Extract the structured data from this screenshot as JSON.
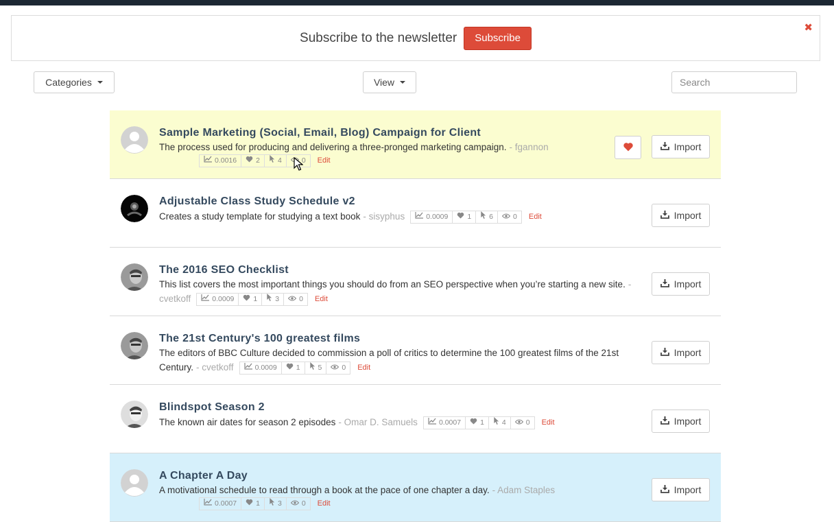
{
  "newsletter": {
    "text": "Subscribe to the newsletter",
    "button_label": "Subscribe",
    "close": "✖"
  },
  "toolbar": {
    "categories_label": "Categories",
    "view_label": "View",
    "search_placeholder": "Search"
  },
  "actions": {
    "import_label": "Import",
    "edit_label": "Edit"
  },
  "colors": {
    "accent": "#dd4b39",
    "highlight_yellow": "#fbfdd0",
    "highlight_blue": "#d6f0fb",
    "title": "#34495e"
  },
  "items": [
    {
      "title": "Sample Marketing (Social, Email, Blog) Campaign for Client",
      "description": "The process used for producing and delivering a three-pronged marketing campaign.",
      "author": "- fgannon",
      "score": "0.0016",
      "likes": "2",
      "clicks": "4",
      "views": "0",
      "highlight": "yellow",
      "liked": true,
      "avatar": "placeholder"
    },
    {
      "title": "Adjustable Class Study Schedule v2",
      "description": "Creates a study template for studying a text book",
      "author": "- sisyphus",
      "score": "0.0009",
      "likes": "1",
      "clicks": "6",
      "views": "0",
      "highlight": "none",
      "avatar": "dark"
    },
    {
      "title": "The 2016 SEO Checklist",
      "description": "This list covers the most important things you should do from an SEO perspective when you’re starting a new site.",
      "author": "- cvetkoff",
      "score": "0.0009",
      "likes": "1",
      "clicks": "3",
      "views": "0",
      "highlight": "none",
      "avatar": "photo"
    },
    {
      "title": "The 21st Century's 100 greatest films",
      "description": "The editors of BBC Culture decided to commission a poll of critics to determine the 100 greatest films of the 21st Century.",
      "author": "- cvetkoff",
      "score": "0.0009",
      "likes": "1",
      "clicks": "5",
      "views": "0",
      "highlight": "none",
      "avatar": "photo"
    },
    {
      "title": "Blindspot Season 2",
      "description": "The known air dates for season 2 episodes",
      "author": "- Omar D. Samuels",
      "score": "0.0007",
      "likes": "1",
      "clicks": "4",
      "views": "0",
      "highlight": "none",
      "avatar": "photo-light"
    },
    {
      "title": "A Chapter A Day",
      "description": "A motivational schedule to read through a book at the pace of one chapter a day.",
      "author": "- Adam Staples",
      "score": "0.0007",
      "likes": "1",
      "clicks": "3",
      "views": "0",
      "highlight": "blue",
      "avatar": "placeholder"
    }
  ]
}
